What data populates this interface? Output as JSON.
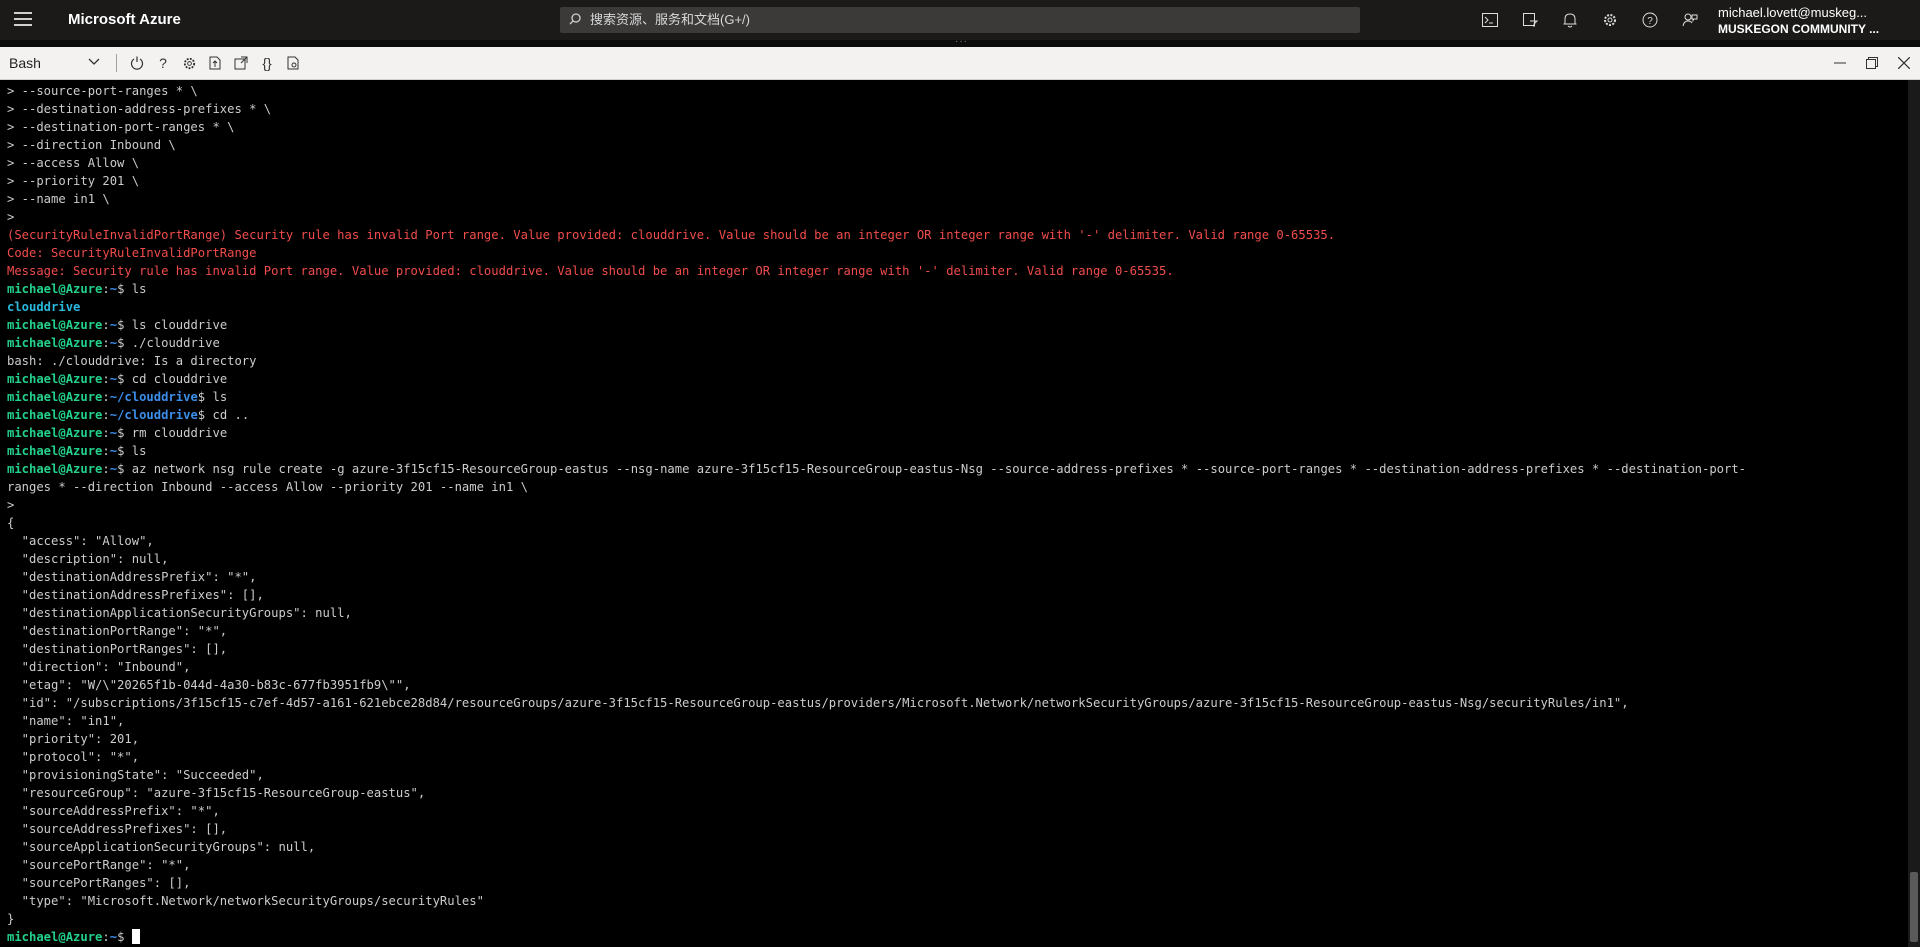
{
  "header": {
    "brand": "Microsoft Azure",
    "search_placeholder": "搜索资源、服务和文档(G+/)",
    "user_email": "michael.lovett@muskeg...",
    "user_org": "MUSKEGON COMMUNITY ...",
    "icons": [
      "cloud-shell-icon",
      "directory-filter-icon",
      "notifications-icon",
      "settings-icon",
      "help-icon",
      "feedback-icon"
    ]
  },
  "shell": {
    "selector_value": "Bash",
    "tools": [
      "restart-icon",
      "help-icon",
      "settings-icon",
      "upload-download-icon",
      "open-new-session-icon",
      "editor-braces-icon",
      "web-preview-icon"
    ],
    "window_controls": [
      "minimize-icon",
      "maximize-icon",
      "close-icon"
    ]
  },
  "terminal": {
    "lines": [
      {
        "type": "plain",
        "text": "> --source-port-ranges * \\"
      },
      {
        "type": "plain",
        "text": "> --destination-address-prefixes * \\"
      },
      {
        "type": "plain",
        "text": "> --destination-port-ranges * \\"
      },
      {
        "type": "plain",
        "text": "> --direction Inbound \\"
      },
      {
        "type": "plain",
        "text": "> --access Allow \\"
      },
      {
        "type": "plain",
        "text": "> --priority 201 \\"
      },
      {
        "type": "plain",
        "text": "> --name in1 \\"
      },
      {
        "type": "plain",
        "text": ">"
      },
      {
        "type": "error",
        "text": "(SecurityRuleInvalidPortRange) Security rule has invalid Port range. Value provided: clouddrive. Value should be an integer OR integer range with '-' delimiter. Valid range 0-65535."
      },
      {
        "type": "error",
        "text": "Code: SecurityRuleInvalidPortRange"
      },
      {
        "type": "error",
        "text": "Message: Security rule has invalid Port range. Value provided: clouddrive. Value should be an integer OR integer range with '-' delimiter. Valid range 0-65535."
      },
      {
        "type": "prompt",
        "user": "michael@Azure",
        "path": "~",
        "cmd": "ls"
      },
      {
        "type": "dir",
        "text": "clouddrive"
      },
      {
        "type": "prompt",
        "user": "michael@Azure",
        "path": "~",
        "cmd": "ls clouddrive"
      },
      {
        "type": "prompt",
        "user": "michael@Azure",
        "path": "~",
        "cmd": "./clouddrive"
      },
      {
        "type": "plain",
        "text": "bash: ./clouddrive: Is a directory"
      },
      {
        "type": "prompt",
        "user": "michael@Azure",
        "path": "~",
        "cmd": "cd clouddrive"
      },
      {
        "type": "prompt",
        "user": "michael@Azure",
        "path": "~/clouddrive",
        "cmd": "ls"
      },
      {
        "type": "prompt",
        "user": "michael@Azure",
        "path": "~/clouddrive",
        "cmd": "cd .."
      },
      {
        "type": "prompt",
        "user": "michael@Azure",
        "path": "~",
        "cmd": "rm clouddrive"
      },
      {
        "type": "prompt",
        "user": "michael@Azure",
        "path": "~",
        "cmd": "ls"
      },
      {
        "type": "prompt",
        "user": "michael@Azure",
        "path": "~",
        "cmd": "az network nsg rule create -g azure-3f15cf15-ResourceGroup-eastus --nsg-name azure-3f15cf15-ResourceGroup-eastus-Nsg --source-address-prefixes * --source-port-ranges * --destination-address-prefixes * --destination-port-"
      },
      {
        "type": "plain",
        "text": "ranges * --direction Inbound --access Allow --priority 201 --name in1 \\"
      },
      {
        "type": "plain",
        "text": ">"
      },
      {
        "type": "plain",
        "text": "{"
      },
      {
        "type": "plain",
        "text": "  \"access\": \"Allow\","
      },
      {
        "type": "plain",
        "text": "  \"description\": null,"
      },
      {
        "type": "plain",
        "text": "  \"destinationAddressPrefix\": \"*\","
      },
      {
        "type": "plain",
        "text": "  \"destinationAddressPrefixes\": [],"
      },
      {
        "type": "plain",
        "text": "  \"destinationApplicationSecurityGroups\": null,"
      },
      {
        "type": "plain",
        "text": "  \"destinationPortRange\": \"*\","
      },
      {
        "type": "plain",
        "text": "  \"destinationPortRanges\": [],"
      },
      {
        "type": "plain",
        "text": "  \"direction\": \"Inbound\","
      },
      {
        "type": "plain",
        "text": "  \"etag\": \"W/\\\"20265f1b-044d-4a30-b83c-677fb3951fb9\\\"\","
      },
      {
        "type": "plain",
        "text": "  \"id\": \"/subscriptions/3f15cf15-c7ef-4d57-a161-621ebce28d84/resourceGroups/azure-3f15cf15-ResourceGroup-eastus/providers/Microsoft.Network/networkSecurityGroups/azure-3f15cf15-ResourceGroup-eastus-Nsg/securityRules/in1\","
      },
      {
        "type": "plain",
        "text": "  \"name\": \"in1\","
      },
      {
        "type": "plain",
        "text": "  \"priority\": 201,"
      },
      {
        "type": "plain",
        "text": "  \"protocol\": \"*\","
      },
      {
        "type": "plain",
        "text": "  \"provisioningState\": \"Succeeded\","
      },
      {
        "type": "plain",
        "text": "  \"resourceGroup\": \"azure-3f15cf15-ResourceGroup-eastus\","
      },
      {
        "type": "plain",
        "text": "  \"sourceAddressPrefix\": \"*\","
      },
      {
        "type": "plain",
        "text": "  \"sourceAddressPrefixes\": [],"
      },
      {
        "type": "plain",
        "text": "  \"sourceApplicationSecurityGroups\": null,"
      },
      {
        "type": "plain",
        "text": "  \"sourcePortRange\": \"*\","
      },
      {
        "type": "plain",
        "text": "  \"sourcePortRanges\": [],"
      },
      {
        "type": "plain",
        "text": "  \"type\": \"Microsoft.Network/networkSecurityGroups/securityRules\""
      },
      {
        "type": "plain",
        "text": "}"
      },
      {
        "type": "prompt",
        "user": "michael@Azure",
        "path": "~",
        "cmd": "",
        "cursor": true
      }
    ]
  }
}
